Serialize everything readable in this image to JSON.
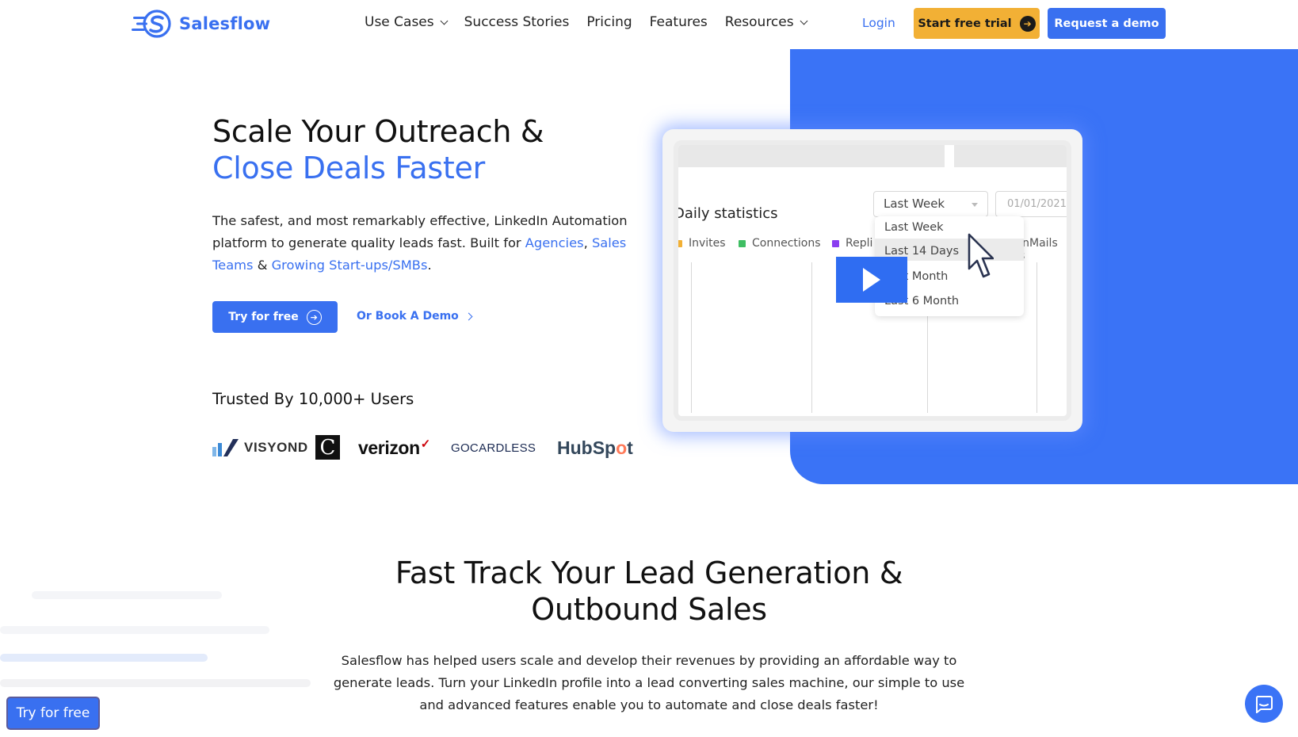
{
  "header": {
    "brand": "Salesflow",
    "nav": [
      {
        "label": "Use Cases",
        "has_dropdown": true
      },
      {
        "label": "Success Stories",
        "has_dropdown": false
      },
      {
        "label": "Pricing",
        "has_dropdown": false
      },
      {
        "label": "Features",
        "has_dropdown": false
      },
      {
        "label": "Resources",
        "has_dropdown": true
      }
    ],
    "login": "Login",
    "trial_button": "Start free trial",
    "demo_button": "Request a demo"
  },
  "hero": {
    "title_line1": "Scale Your Outreach &",
    "title_line2": "Close Deals Faster",
    "desc_part1": "The safest, and most remarkably effective, LinkedIn Automation platform to generate quality leads fast. Built for ",
    "link_agencies": "Agencies",
    "sep1": ", ",
    "link_sales_teams": "Sales Teams",
    "sep2": " & ",
    "link_startups": "Growing Start-ups/SMBs",
    "end": ".",
    "try_button": "Try for free",
    "book_demo": "Or Book A Demo",
    "trusted": "Trusted By 10,000+ Users",
    "logos": {
      "visyond": "VISYOND",
      "c_mark": "C",
      "verizon": "verizon",
      "gocardless": "GOCARDLESS",
      "hubspot_a": "HubSp",
      "hubspot_o": "o",
      "hubspot_b": "t"
    }
  },
  "video": {
    "title": "Daily statistics",
    "select_value": "Last Week",
    "date_value": "01/01/2021",
    "legend": [
      {
        "label": "Invites",
        "color": "#f2b035"
      },
      {
        "label": "Connections",
        "color": "#3fbe63"
      },
      {
        "label": "Repli",
        "color": "#8a3df0"
      },
      {
        "label": "InMails s",
        "color": "#ffffff"
      }
    ],
    "dropdown_options": [
      "Last Week",
      "Last 14 Days",
      "Last Month",
      "Last 6 Month"
    ],
    "play_icon": "play-icon"
  },
  "section2": {
    "title_line1": "Fast Track Your Lead Generation &",
    "title_line2": "Outbound Sales",
    "desc": "Salesflow has helped users scale and develop their revenues by providing an affordable way to generate leads. Turn your LinkedIn profile into a lead converting sales machine, our simple to use and advanced features enable you to automate and close deals faster!"
  },
  "floating": {
    "try_button": "Try for free",
    "chat_icon": "chat-icon"
  },
  "colors": {
    "accent": "#3970f0",
    "trial": "#f2b035",
    "panel": "#3a73f6"
  }
}
